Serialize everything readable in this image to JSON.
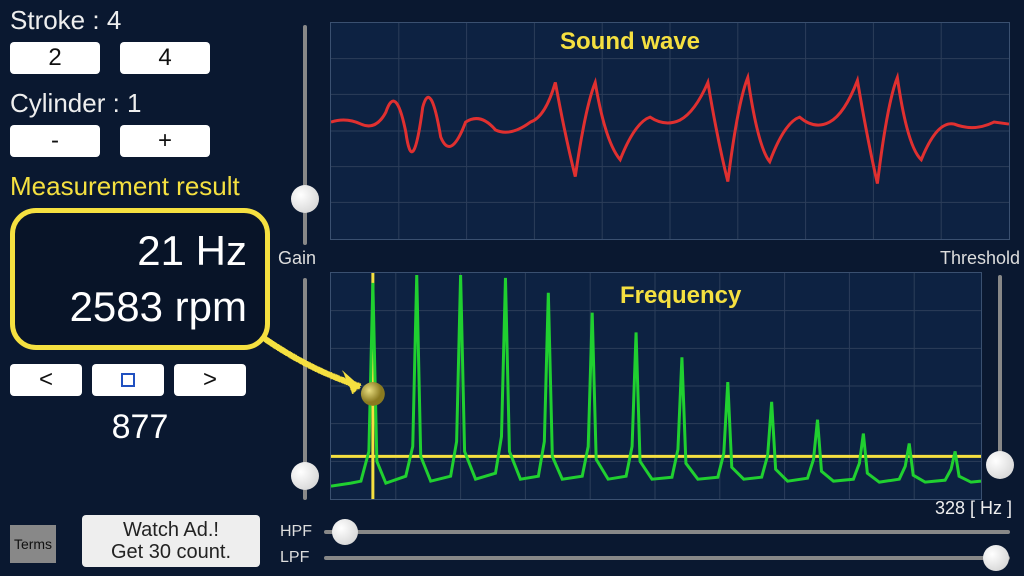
{
  "stroke": {
    "label": "Stroke : 4",
    "opt2": "2",
    "opt4": "4"
  },
  "cylinder": {
    "label": "Cylinder : 1",
    "minus": "-",
    "plus": "+"
  },
  "measurement": {
    "title": "Measurement result",
    "hz": "21 Hz",
    "rpm": "2583 rpm"
  },
  "nav": {
    "prev": "<",
    "stop": "",
    "next": ">"
  },
  "ad_count": "877",
  "ad_button": "Watch Ad.!\nGet 30 count.",
  "terms": "Terms",
  "gain_label": "Gain",
  "threshold_label": "Threshold",
  "sound_title": "Sound wave",
  "freq_title": "Frequency",
  "hpf_label": "HPF",
  "lpf_label": "LPF",
  "hz_readout": "328 [ Hz ]",
  "colors": {
    "accent": "#f5e040",
    "wave": "#e03030",
    "freq": "#20d030"
  }
}
